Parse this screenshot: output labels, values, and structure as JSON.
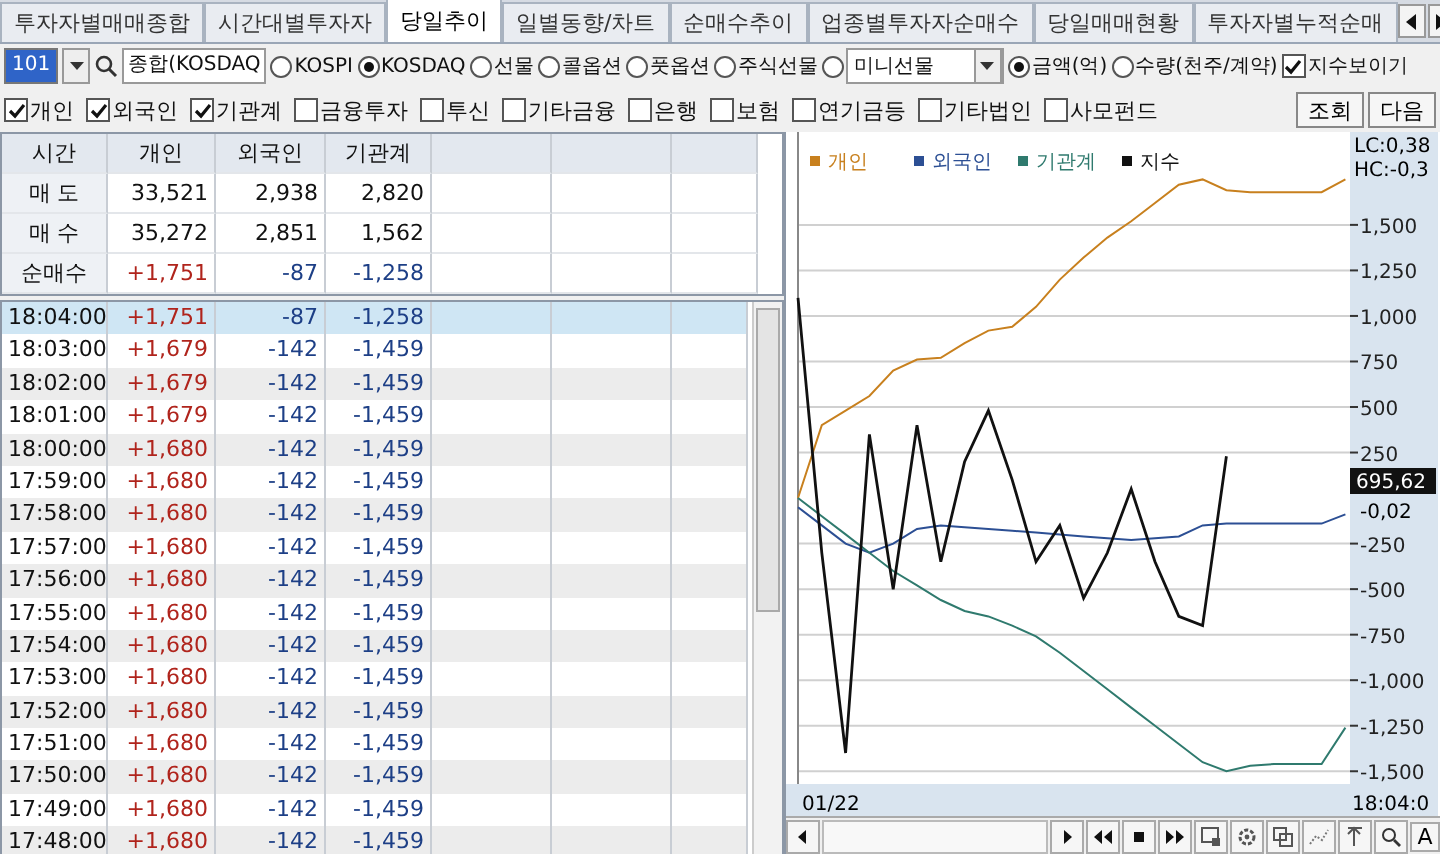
{
  "tabs": [
    {
      "label": "투자자별매매종합",
      "selected": false
    },
    {
      "label": "시간대별투자자",
      "selected": false
    },
    {
      "label": "당일추이",
      "selected": true
    },
    {
      "label": "일별동향/차트",
      "selected": false
    },
    {
      "label": "순매수추이",
      "selected": false
    },
    {
      "label": "업종별투자자순매수",
      "selected": false
    },
    {
      "label": "당일매매현황",
      "selected": false
    },
    {
      "label": "투자자별누적순매",
      "selected": false
    }
  ],
  "toolbar": {
    "code": "101",
    "name": "종합(KOSDAQ",
    "markets": [
      {
        "kind": "radio",
        "label": "KOSPI",
        "selected": false
      },
      {
        "kind": "radio",
        "label": "KOSDAQ",
        "selected": true
      },
      {
        "kind": "radio",
        "label": "선물",
        "selected": false
      },
      {
        "kind": "radio",
        "label": "콜옵션",
        "selected": false
      },
      {
        "kind": "radio",
        "label": "풋옵션",
        "selected": false
      },
      {
        "kind": "radio",
        "label": "주식선물",
        "selected": false
      },
      {
        "kind": "select",
        "value": "미니선물",
        "selected": false
      }
    ],
    "units": [
      {
        "label": "금액(억)",
        "selected": true
      },
      {
        "label": "수량(천주/계약)",
        "selected": false
      }
    ],
    "show_index": {
      "label": "지수보이기",
      "checked": true
    }
  },
  "filters": [
    {
      "label": "개인",
      "checked": true
    },
    {
      "label": "외국인",
      "checked": true
    },
    {
      "label": "기관계",
      "checked": true
    },
    {
      "label": "금융투자",
      "checked": false
    },
    {
      "label": "투신",
      "checked": false
    },
    {
      "label": "기타금융",
      "checked": false
    },
    {
      "label": "은행",
      "checked": false
    },
    {
      "label": "보험",
      "checked": false
    },
    {
      "label": "연기금등",
      "checked": false
    },
    {
      "label": "기타법인",
      "checked": false
    },
    {
      "label": "사모펀드",
      "checked": false
    }
  ],
  "buttons": [
    "조회",
    "다음"
  ],
  "summary": {
    "columns": [
      "시간",
      "개인",
      "외국인",
      "기관계"
    ],
    "rows": [
      {
        "label": "매 도",
        "kind": "plain",
        "values": [
          "33,521",
          "2,938",
          "2,820"
        ]
      },
      {
        "label": "매 수",
        "kind": "plain",
        "values": [
          "35,272",
          "2,851",
          "1,562"
        ]
      },
      {
        "label": "순매수",
        "kind": "net",
        "values": [
          "+1,751",
          "-87",
          "-1,258"
        ]
      }
    ]
  },
  "rows": [
    {
      "time": "18:04:00",
      "values": [
        "+1,751",
        "-87",
        "-1,258"
      ],
      "selected": true
    },
    {
      "time": "18:03:00",
      "values": [
        "+1,679",
        "-142",
        "-1,459"
      ],
      "selected": false
    },
    {
      "time": "18:02:00",
      "values": [
        "+1,679",
        "-142",
        "-1,459"
      ],
      "selected": false
    },
    {
      "time": "18:01:00",
      "values": [
        "+1,679",
        "-142",
        "-1,459"
      ],
      "selected": false
    },
    {
      "time": "18:00:00",
      "values": [
        "+1,680",
        "-142",
        "-1,459"
      ],
      "selected": false
    },
    {
      "time": "17:59:00",
      "values": [
        "+1,680",
        "-142",
        "-1,459"
      ],
      "selected": false
    },
    {
      "time": "17:58:00",
      "values": [
        "+1,680",
        "-142",
        "-1,459"
      ],
      "selected": false
    },
    {
      "time": "17:57:00",
      "values": [
        "+1,680",
        "-142",
        "-1,459"
      ],
      "selected": false
    },
    {
      "time": "17:56:00",
      "values": [
        "+1,680",
        "-142",
        "-1,459"
      ],
      "selected": false
    },
    {
      "time": "17:55:00",
      "values": [
        "+1,680",
        "-142",
        "-1,459"
      ],
      "selected": false
    },
    {
      "time": "17:54:00",
      "values": [
        "+1,680",
        "-142",
        "-1,459"
      ],
      "selected": false
    },
    {
      "time": "17:53:00",
      "values": [
        "+1,680",
        "-142",
        "-1,459"
      ],
      "selected": false
    },
    {
      "time": "17:52:00",
      "values": [
        "+1,680",
        "-142",
        "-1,459"
      ],
      "selected": false
    },
    {
      "time": "17:51:00",
      "values": [
        "+1,680",
        "-142",
        "-1,459"
      ],
      "selected": false
    },
    {
      "time": "17:50:00",
      "values": [
        "+1,680",
        "-142",
        "-1,459"
      ],
      "selected": false
    },
    {
      "time": "17:49:00",
      "values": [
        "+1,680",
        "-142",
        "-1,459"
      ],
      "selected": false
    },
    {
      "time": "17:48:00",
      "values": [
        "+1,680",
        "-142",
        "-1,459"
      ],
      "selected": false
    }
  ],
  "chart": {
    "lc": "LC:0,38",
    "hc": "HC:-0,3",
    "current_value": "695,62",
    "index_label": "-0,02",
    "start_label": "01/22",
    "end_label": "18:04:0",
    "font_button": "A",
    "chart_data": {
      "type": "line",
      "grid": true,
      "legend": true,
      "ylim": [
        -1570,
        2010
      ],
      "yticks": [
        {
          "value": 1500,
          "label": "1,500"
        },
        {
          "value": 1250,
          "label": "1,250"
        },
        {
          "value": 1000,
          "label": "1,000"
        },
        {
          "value": 750,
          "label": "750"
        },
        {
          "value": 500,
          "label": "500"
        },
        {
          "value": 250,
          "label": "250"
        },
        {
          "value": -250,
          "label": "-250"
        },
        {
          "value": -500,
          "label": "-500"
        },
        {
          "value": -750,
          "label": "-750"
        },
        {
          "value": -1000,
          "label": "-1,000"
        },
        {
          "value": -1250,
          "label": "-1,250"
        },
        {
          "value": -1500,
          "label": "-1,500"
        }
      ],
      "series": [
        {
          "name": "개인",
          "color": "#c8801e",
          "values": [
            0,
            400,
            480,
            560,
            700,
            760,
            770,
            850,
            920,
            940,
            1050,
            1200,
            1320,
            1430,
            1520,
            1620,
            1720,
            1750,
            1690,
            1680,
            1680,
            1680,
            1680,
            1750
          ]
        },
        {
          "name": "외국인",
          "color": "#2c4f94",
          "values": [
            -50,
            -150,
            -250,
            -300,
            -250,
            -170,
            -150,
            -160,
            -170,
            -180,
            -190,
            -200,
            -210,
            -220,
            -230,
            -220,
            -210,
            -150,
            -140,
            -140,
            -140,
            -140,
            -140,
            -90
          ]
        },
        {
          "name": "기관계",
          "color": "#2f7a6e",
          "values": [
            0,
            -100,
            -200,
            -300,
            -400,
            -480,
            -560,
            -620,
            -650,
            -700,
            -760,
            -850,
            -950,
            -1050,
            -1150,
            -1250,
            -1350,
            -1450,
            -1500,
            -1470,
            -1460,
            -1460,
            -1460,
            -1260
          ]
        },
        {
          "name": "지수",
          "color": "#111111",
          "values": [
            1100,
            -300,
            -1400,
            350,
            -500,
            400,
            -350,
            200,
            480,
            100,
            -350,
            -150,
            -550,
            -300,
            50,
            -350,
            -650,
            -700,
            230,
            null,
            null,
            null,
            null,
            null
          ]
        }
      ]
    }
  }
}
